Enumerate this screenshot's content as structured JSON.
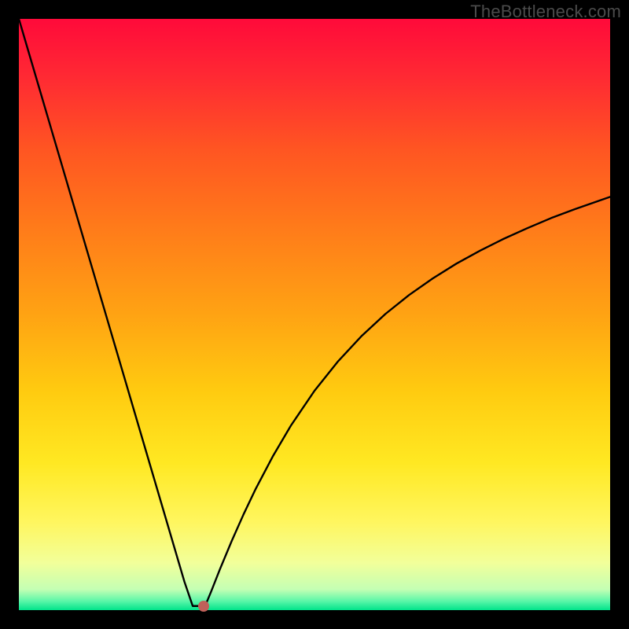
{
  "watermark": "TheBottleneck.com",
  "gradient": {
    "stops": [
      {
        "offset": 0.0,
        "color": "#ff0a3a"
      },
      {
        "offset": 0.1,
        "color": "#ff2a33"
      },
      {
        "offset": 0.22,
        "color": "#ff5522"
      },
      {
        "offset": 0.35,
        "color": "#ff7a1a"
      },
      {
        "offset": 0.5,
        "color": "#ffa313"
      },
      {
        "offset": 0.63,
        "color": "#ffcb10"
      },
      {
        "offset": 0.75,
        "color": "#ffe822"
      },
      {
        "offset": 0.85,
        "color": "#fff65e"
      },
      {
        "offset": 0.92,
        "color": "#f2ff9a"
      },
      {
        "offset": 0.965,
        "color": "#c4ffb4"
      },
      {
        "offset": 0.985,
        "color": "#59f6a8"
      },
      {
        "offset": 1.0,
        "color": "#00e38a"
      }
    ]
  },
  "chart_data": {
    "type": "line",
    "title": "",
    "xlabel": "",
    "ylabel": "",
    "xlim": [
      0,
      100
    ],
    "ylim": [
      0,
      100
    ],
    "series": [
      {
        "name": "bottleneck-curve",
        "x": [
          0,
          2,
          4,
          6,
          8,
          10,
          12,
          14,
          16,
          18,
          20,
          22,
          24,
          26,
          28,
          29.4,
          30.6,
          31.5,
          32.5,
          34,
          36,
          38,
          40,
          43,
          46,
          50,
          54,
          58,
          62,
          66,
          70,
          74,
          78,
          82,
          86,
          90,
          94,
          98,
          100
        ],
        "y": [
          100,
          93.2,
          86.4,
          79.6,
          72.8,
          66.0,
          59.2,
          52.4,
          45.6,
          38.8,
          32.0,
          25.2,
          18.4,
          11.6,
          4.8,
          0.7,
          0.7,
          0.7,
          3.1,
          6.9,
          11.7,
          16.2,
          20.4,
          26.1,
          31.2,
          37.1,
          42.1,
          46.4,
          50.1,
          53.3,
          56.1,
          58.6,
          60.8,
          62.8,
          64.6,
          66.3,
          67.8,
          69.2,
          69.9
        ]
      }
    ],
    "marker": {
      "x": 31.2,
      "y": 0.7
    }
  }
}
